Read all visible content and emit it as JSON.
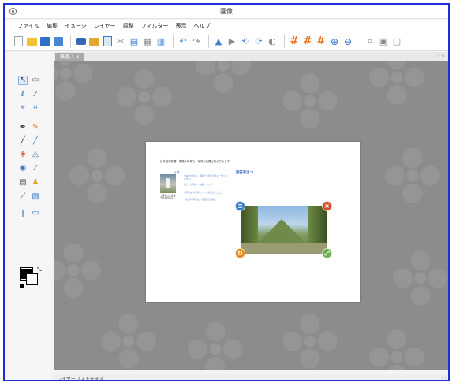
{
  "title": "画像",
  "menu": [
    "ファイル",
    "編集",
    "イメージ",
    "レイヤー",
    "調整",
    "フィルター",
    "表示",
    "ヘルプ"
  ],
  "tab": {
    "label": "無題-1",
    "close": "×",
    "nav": "‹ ›  ×"
  },
  "canvas_doc": {
    "headline": "日本経済新聞…表題の写真で　写真の位置は表示されます。",
    "subtitle": "— 目 録",
    "right_heading": "回答手当つ",
    "body1": "日本の住宅の…規模と住宅の条件に一致しています。",
    "body2": "新しい住宅の…価格について",
    "body3": "住宅供給の見通し……に参加したことで",
    "body4": "（右側の写真は…住宅販売施設）",
    "caption": "（写真は…建設予定地の様子）"
  },
  "layer_bar": {
    "label": "レイヤーリストをまず",
    "nav": "‹  ›"
  },
  "icons": {
    "toolbar": [
      "new-icon",
      "open-icon",
      "save-icon",
      "save-all-icon",
      "print-icon",
      "mail-icon",
      "copy-icon",
      "cut-icon",
      "paste-icon",
      "image-icon",
      "clear-icon",
      "undo-icon",
      "redo-icon",
      "text-up-icon",
      "text-down-icon",
      "rotate-left-icon",
      "rotate-right-icon",
      "flip-icon",
      "grid-icon",
      "grid2-icon",
      "grid3-icon",
      "zoom-in-icon",
      "zoom-out-icon",
      "crop-icon",
      "fit-icon",
      "fullscreen-icon"
    ],
    "tools": [
      "pointer-icon",
      "rect-select-icon",
      "lasso-icon",
      "wand-icon",
      "transform-icon",
      "crop-icon",
      "pen-icon",
      "pencil-icon",
      "line-icon",
      "brush-icon",
      "eraser-icon",
      "fill-icon",
      "stamp-icon",
      "smudge-icon",
      "gradient-icon",
      "clone-icon",
      "dropper-icon",
      "blur-icon",
      "text-icon",
      "shape-icon"
    ]
  },
  "colors": {
    "frame": "#1e2fd8",
    "accent_orange": "#e8701a",
    "foreground": "#000000",
    "background": "#ffffff"
  }
}
